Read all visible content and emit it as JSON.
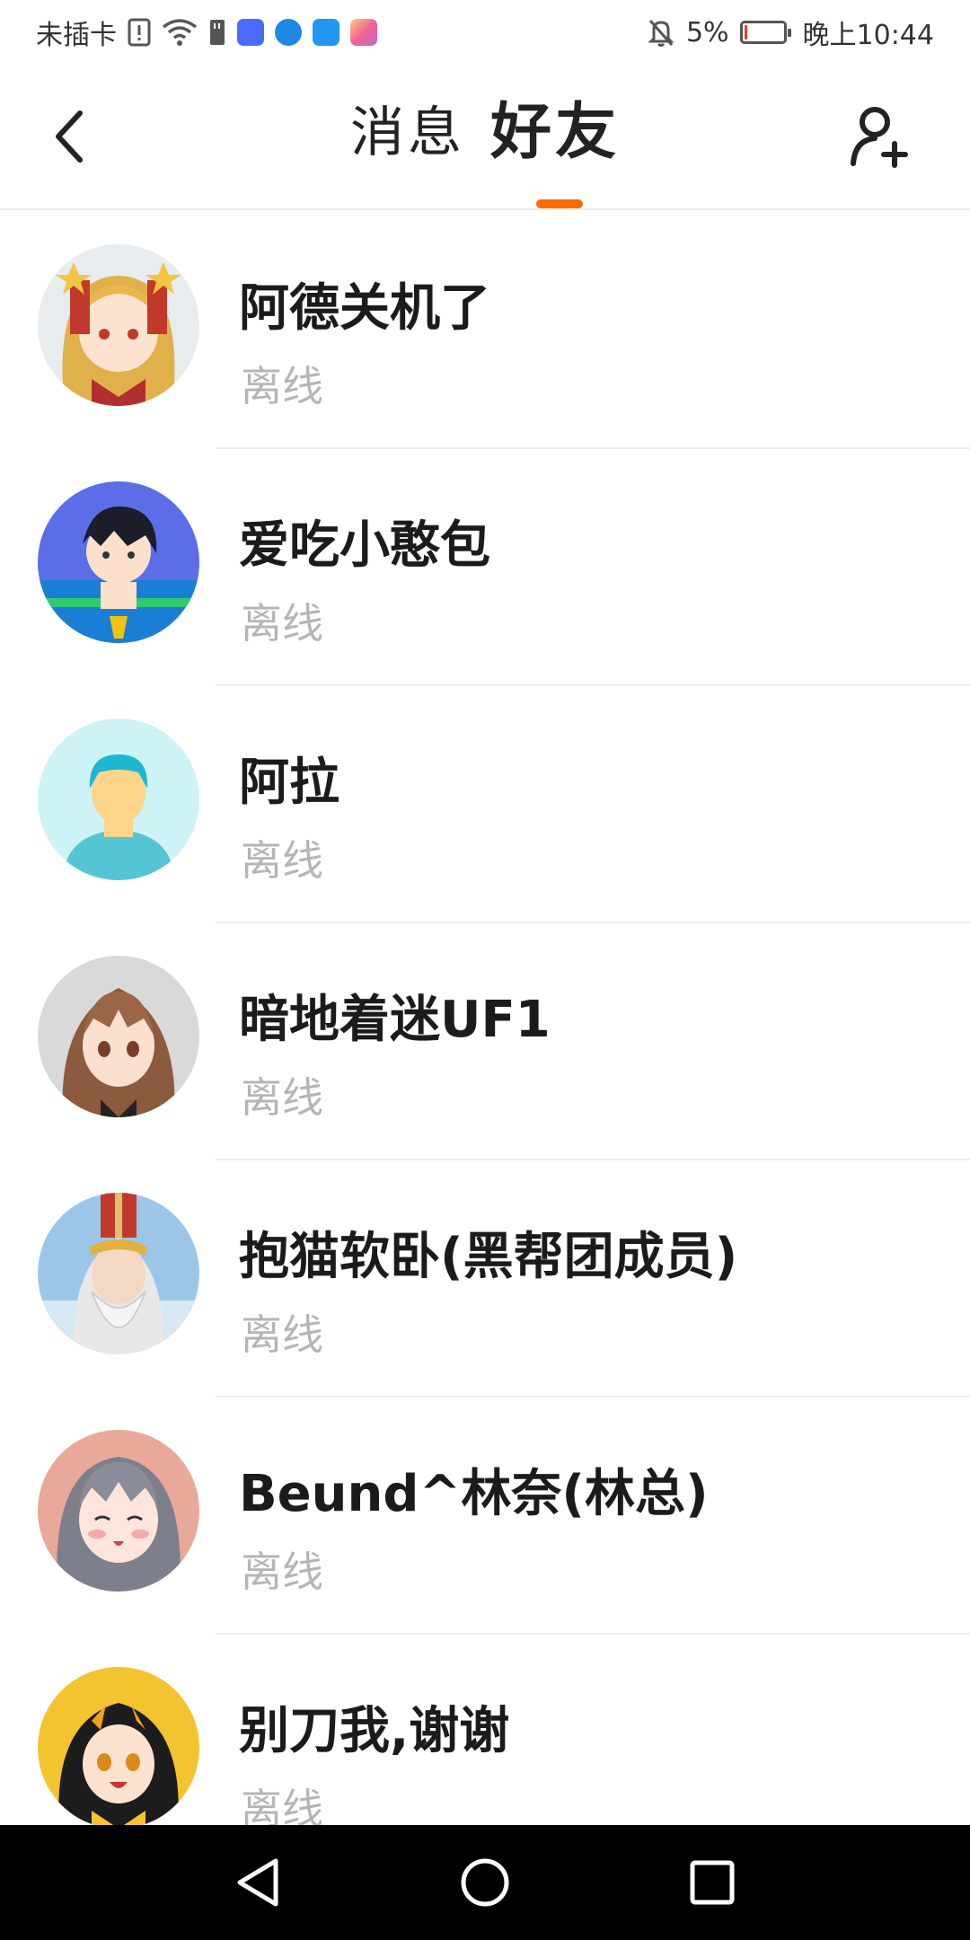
{
  "status_bar": {
    "carrier": "未插卡",
    "battery_percent": "5%",
    "time": "晚上10:44",
    "app_badges": [
      {
        "name": "music-app-icon",
        "color": "#4b6bff"
      },
      {
        "name": "browser-app-icon",
        "color": "#1e88e5"
      },
      {
        "name": "weather-app-icon",
        "color": "#2196f3"
      },
      {
        "name": "gallery-app-icon",
        "color": "#f06292"
      }
    ]
  },
  "header": {
    "tabs": [
      {
        "label": "消息",
        "active": false
      },
      {
        "label": "好友",
        "active": true
      }
    ],
    "accent_color": "#ff6a00"
  },
  "friends": [
    {
      "name": "阿德关机了",
      "status": "离线",
      "avatar": "anime-girl-blonde-avatar"
    },
    {
      "name": "爱吃小憨包",
      "status": "离线",
      "avatar": "anime-boy-blue-avatar"
    },
    {
      "name": "阿拉",
      "status": "离线",
      "avatar": "default-user-avatar"
    },
    {
      "name": "暗地着迷UF1",
      "status": "离线",
      "avatar": "anime-girl-brown-hair-avatar"
    },
    {
      "name": "抱猫软卧(黑帮团成员)",
      "status": "离线",
      "avatar": "anime-old-sage-avatar"
    },
    {
      "name": "Beund^林奈(林总)",
      "status": "离线",
      "avatar": "anime-girl-grey-hair-avatar"
    },
    {
      "name": "别刀我,谢谢",
      "status": "离线",
      "avatar": "anime-girl-tiger-avatar"
    }
  ],
  "nav_bar": {
    "back": "nav-back-icon",
    "home": "nav-home-icon",
    "recents": "nav-recents-icon"
  }
}
